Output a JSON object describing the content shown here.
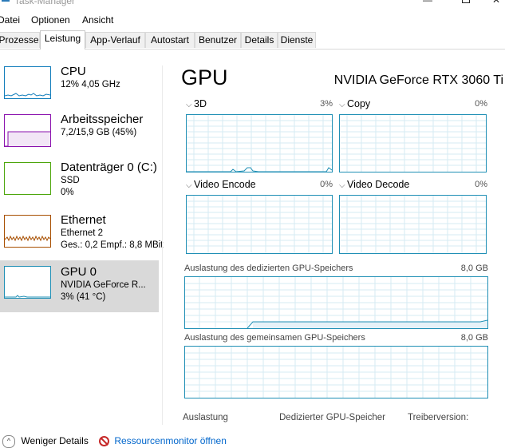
{
  "window": {
    "title": "Task-Manager"
  },
  "menu": [
    "Datei",
    "Optionen",
    "Ansicht"
  ],
  "tabs": [
    "Prozesse",
    "Leistung",
    "App-Verlauf",
    "Autostart",
    "Benutzer",
    "Details",
    "Dienste"
  ],
  "sidebar": {
    "items": [
      {
        "title": "CPU",
        "line1": "12% 4,05 GHz",
        "line2": "",
        "color": "#117dbb"
      },
      {
        "title": "Arbeitsspeicher",
        "line1": "7,2/15,9 GB (45%)",
        "line2": "",
        "color": "#8b12ae"
      },
      {
        "title": "Datenträger 0 (C:)",
        "line1": "SSD",
        "line2": "0%",
        "color": "#4da60c"
      },
      {
        "title": "Ethernet",
        "line1": "Ethernet 2",
        "line2": "Ges.: 0,2  Empf.: 8,8 MBit",
        "color": "#a74f01"
      },
      {
        "title": "GPU 0",
        "line1": "NVIDIA GeForce R...",
        "line2": "3% (41 °C)",
        "color": "#1f8fb5"
      }
    ]
  },
  "main": {
    "heading": "GPU",
    "model": "NVIDIA GeForce RTX 3060 Ti",
    "engines": [
      {
        "label": "3D",
        "percent": "3%"
      },
      {
        "label": "Copy",
        "percent": "0%"
      },
      {
        "label": "Video Encode",
        "percent": "0%"
      },
      {
        "label": "Video Decode",
        "percent": "0%"
      }
    ],
    "dedicated_memory": {
      "label": "Auslastung des dedizierten GPU-Speichers",
      "max": "8,0 GB"
    },
    "shared_memory": {
      "label": "Auslastung des gemeinsamen GPU-Speichers",
      "max": "8,0 GB"
    },
    "footer": {
      "utilization": "Auslastung",
      "dedicated": "Dedizierter GPU-Speicher",
      "driver": "Treiberversion:"
    }
  },
  "bottom": {
    "less_details": "Weniger Details",
    "resource_monitor": "Ressourcenmonitor öffnen"
  },
  "colors": {
    "gpu": "#1f8fb5",
    "tab_bg": "#f0f0f0",
    "selected": "#d9d9d9",
    "link": "#0066cc"
  }
}
